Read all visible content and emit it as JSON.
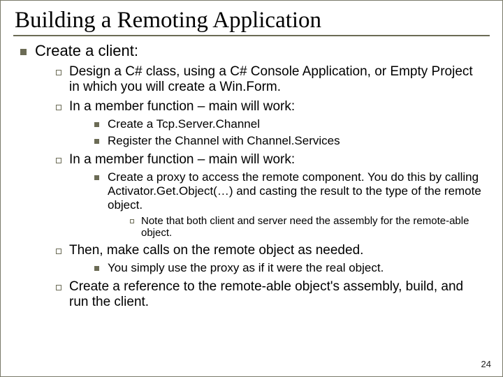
{
  "title": "Building a Remoting Application",
  "page_number": "24",
  "lvl1": {
    "item0": "Create a client:"
  },
  "lvl2": {
    "item0": "Design a C# class, using a C# Console Application, or Empty Project in which you will create a Win.Form.",
    "item1": "In a member function – main will work:",
    "item2": "In a member function – main will work:",
    "item3": "Then, make calls on the remote object as needed.",
    "item4": "Create a reference to the remote-able object's assembly, build, and run the client."
  },
  "lvl3": {
    "item0": "Create a Tcp.Server.Channel",
    "item1": "Register the Channel with Channel.Services",
    "item2": "Create a proxy to access the remote component.  You do this by calling Activator.Get.Object(…) and casting the result to the type of the remote object.",
    "item3": "You simply use the proxy as if it were the real object."
  },
  "lvl4": {
    "item0": "Note that both client and server need the assembly for the remote-able object."
  }
}
